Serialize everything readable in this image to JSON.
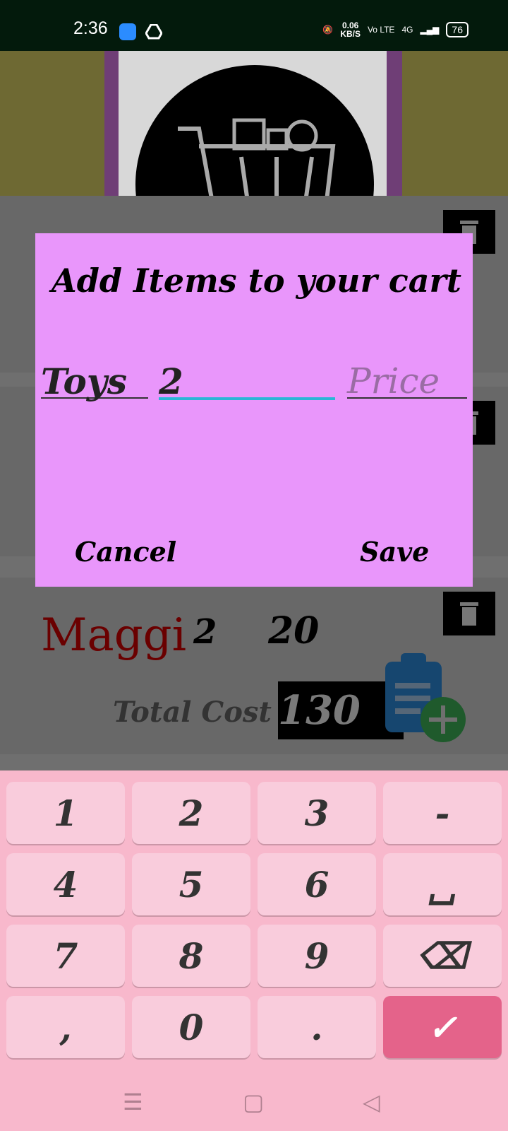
{
  "status_bar": {
    "time": "2:36",
    "net_speed": "0.06",
    "net_unit": "KB/S",
    "volte": "Vo LTE",
    "network": "4G",
    "battery": "76"
  },
  "list": {
    "maggi": {
      "name": "Maggi",
      "qty": "2",
      "price": "20"
    },
    "total_label": "Total Cost",
    "total_value": "130"
  },
  "dialog": {
    "title": "Add Items to your cart",
    "item_value": "Toys",
    "qty_value": "2",
    "price_placeholder": "Price",
    "cancel_label": "Cancel",
    "save_label": "Save"
  },
  "keyboard": {
    "row1": [
      "1",
      "2",
      "3",
      "-"
    ],
    "row2": [
      "4",
      "5",
      "6",
      "␣"
    ],
    "row3": [
      "7",
      "8",
      "9",
      "⌫"
    ],
    "row4": [
      ",",
      "0",
      ".",
      "✓"
    ]
  },
  "nav": {
    "menu": "☰",
    "home": "▢",
    "back": "◁"
  }
}
